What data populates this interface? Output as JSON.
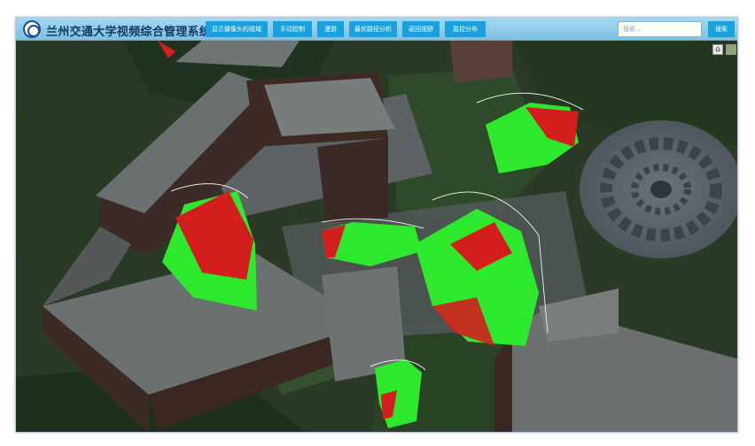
{
  "app": {
    "title": "兰州交通大学视频综合管理系统"
  },
  "nav": [
    {
      "label": "显示摄像头的视域"
    },
    {
      "label": "手动控制"
    },
    {
      "label": "漫游"
    },
    {
      "label": "最优路径分析"
    },
    {
      "label": "返回视野"
    },
    {
      "label": "监控分布"
    }
  ],
  "search": {
    "placeholder": "搜索...",
    "button_label": "搜索"
  },
  "map_controls": {
    "home_icon": "home-icon",
    "layer_icon": "layer-switch-icon"
  },
  "colors": {
    "visible_area": "#2ee82e",
    "blind_area": "#d41e1e",
    "topbar": "#8fcdea",
    "button": "#1aa0df"
  }
}
